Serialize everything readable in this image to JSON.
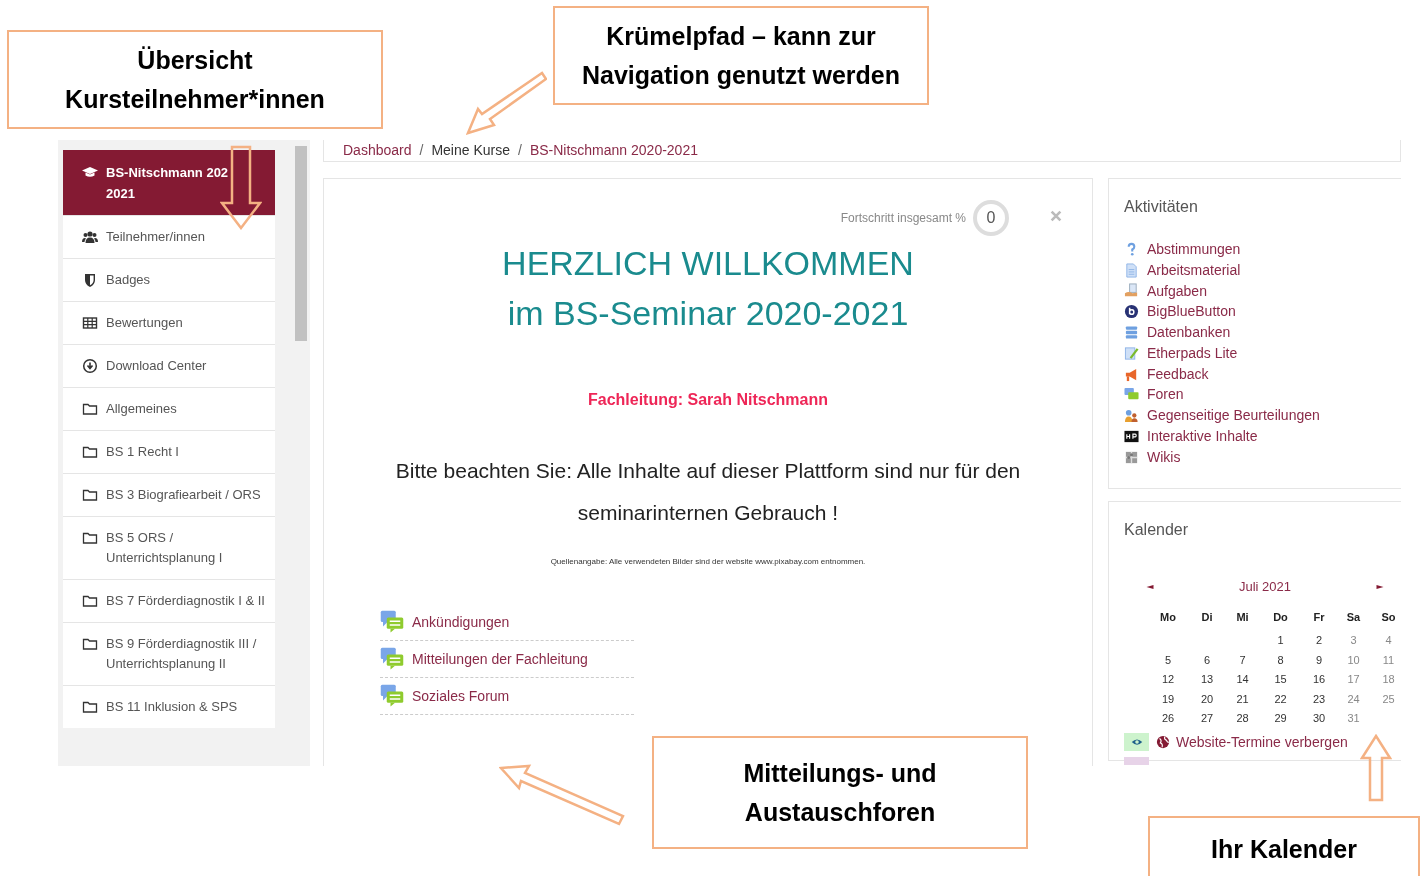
{
  "breadcrumb": [
    {
      "label": "Dashboard",
      "kind": "link"
    },
    {
      "label": "/",
      "kind": "separator"
    },
    {
      "label": "Meine Kurse",
      "kind": "plain"
    },
    {
      "label": "/",
      "kind": "separator"
    },
    {
      "label": "BS-Nitschmann 2020-2021",
      "kind": "link"
    }
  ],
  "sidebar": {
    "items": [
      {
        "label": "BS-Nitschmann 202\n2021",
        "kind": "course",
        "selected": true
      },
      {
        "label": "Teilnehmer/innen",
        "kind": "users",
        "selected": false
      },
      {
        "label": "Badges",
        "kind": "badge",
        "selected": false
      },
      {
        "label": "Bewertungen",
        "kind": "grades",
        "selected": false
      },
      {
        "label": "Download Center",
        "kind": "download",
        "selected": false
      },
      {
        "label": "Allgemeines",
        "kind": "folder",
        "selected": false
      },
      {
        "label": "BS 1 Recht I",
        "kind": "folder",
        "selected": false
      },
      {
        "label": "BS 3 Biografiearbeit / ORS",
        "kind": "folder",
        "selected": false
      },
      {
        "label": "BS 5 ORS / Unterrichtsplanung I",
        "kind": "folder",
        "selected": false
      },
      {
        "label": "BS 7 Förderdiagnostik I & II",
        "kind": "folder",
        "selected": false
      },
      {
        "label": "BS 9 Förderdiagnostik III / Unterrichtsplanung II",
        "kind": "folder",
        "selected": false
      },
      {
        "label": "BS 11 Inklusion & SPS",
        "kind": "folder",
        "selected": false
      }
    ]
  },
  "main": {
    "progress_label": "Fortschritt insgesamt %",
    "progress_value": "0",
    "title_lines": [
      "HERZLICH WILLKOMMEN",
      "im BS-Seminar 2020-2021"
    ],
    "lead": "Fachleitung: Sarah Nitschmann",
    "notice": "Bitte beachten Sie: Alle Inhalte auf dieser Plattform sind nur für den seminarinternen Gebrauch !",
    "source_note": "Quellenangabe: Alle verwendeten Bilder sind der website www.pixabay.com entnommen.",
    "forums": [
      "Ankündigungen",
      "Mitteilungen der Fachleitung",
      "Soziales Forum"
    ]
  },
  "activities": {
    "title": "Aktivitäten",
    "items": [
      {
        "label": "Abstimmungen",
        "kind": "question"
      },
      {
        "label": "Arbeitsmaterial",
        "kind": "document"
      },
      {
        "label": "Aufgaben",
        "kind": "hand"
      },
      {
        "label": "BigBlueButton",
        "kind": "bbb"
      },
      {
        "label": "Datenbanken",
        "kind": "database"
      },
      {
        "label": "Etherpads Lite",
        "kind": "pad"
      },
      {
        "label": "Feedback",
        "kind": "megaphone"
      },
      {
        "label": "Foren",
        "kind": "forum"
      },
      {
        "label": "Gegenseitige Beurteilungen",
        "kind": "people"
      },
      {
        "label": "Interaktive Inhalte",
        "kind": "h5p"
      },
      {
        "label": "Wikis",
        "kind": "wiki"
      }
    ]
  },
  "calendar": {
    "title": "Kalender",
    "month": "Juli 2021",
    "weekdays": [
      "Mo",
      "Di",
      "Mi",
      "Do",
      "Fr",
      "Sa",
      "So"
    ],
    "weeks": [
      [
        "1",
        "2",
        "3",
        "4"
      ],
      [
        "5",
        "6",
        "7",
        "8",
        "9",
        "10",
        "11"
      ],
      [
        "12",
        "13",
        "14",
        "15",
        "16",
        "17",
        "18"
      ],
      [
        "19",
        "20",
        "21",
        "22",
        "23",
        "24",
        "25"
      ],
      [
        "26",
        "27",
        "28",
        "29",
        "30",
        "31"
      ]
    ],
    "filter_label": "Website-Termine verbergen"
  },
  "callouts": [
    {
      "text": "Übersicht\nKursteilnehmer*innen",
      "kind": "participants"
    },
    {
      "text": "Krümelpfad – kann zur\nNavigation genutzt werden",
      "kind": "breadcrumb"
    },
    {
      "text": "Mitteilungs- und\nAustauschforen",
      "kind": "forums"
    },
    {
      "text": "Ihr Kalender",
      "kind": "calendar"
    }
  ]
}
